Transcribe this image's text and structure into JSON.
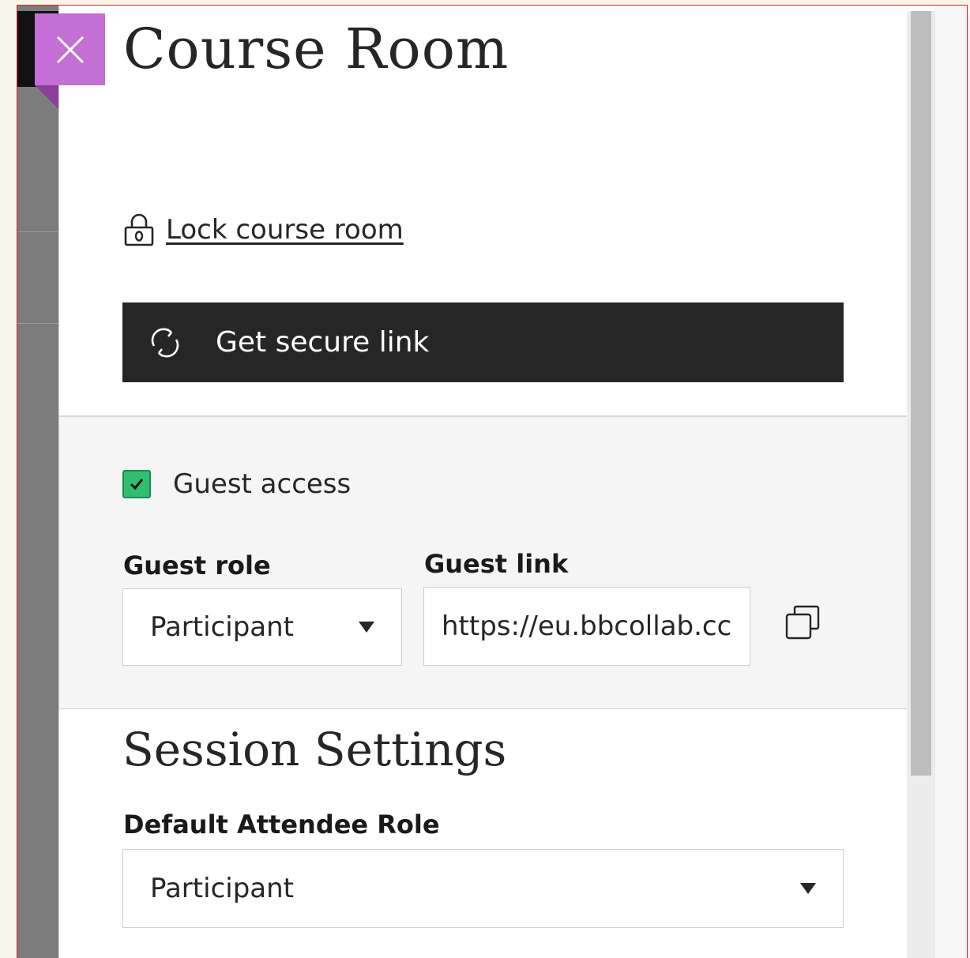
{
  "panel": {
    "title": "Course Room",
    "close_icon": "close-icon"
  },
  "lock": {
    "icon": "lock-icon",
    "label": "Lock course room"
  },
  "secure_link": {
    "icon": "refresh-icon",
    "label": "Get secure link"
  },
  "guest": {
    "access_label": "Guest access",
    "access_checked": true,
    "role_label": "Guest role",
    "role_value": "Participant",
    "link_label": "Guest link",
    "link_value": "https://eu.bbcollab.cc",
    "copy_icon": "copy-icon"
  },
  "session": {
    "title": "Session Settings",
    "default_role_label": "Default Attendee Role",
    "default_role_value": "Participant"
  },
  "colors": {
    "close_accent": "#c46fd6",
    "checkbox_green": "#2fbf71",
    "button_dark": "#262626"
  }
}
